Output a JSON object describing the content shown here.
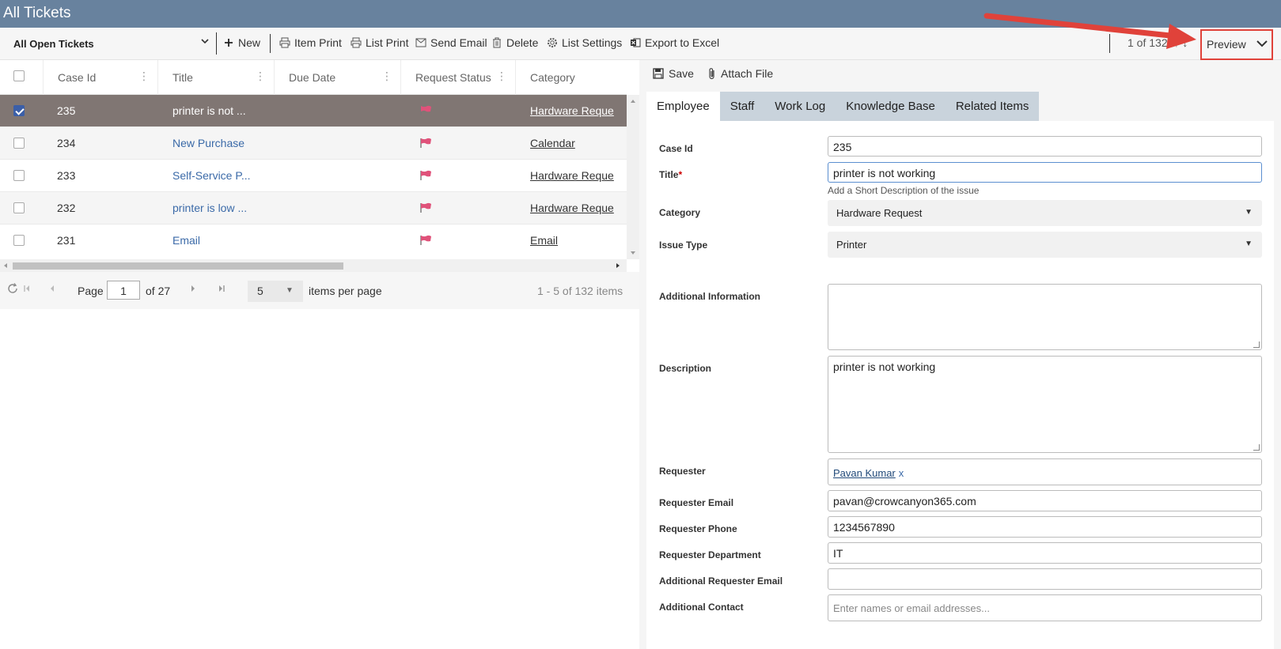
{
  "window": {
    "title": "All Tickets"
  },
  "toolbar": {
    "view": "All Open Tickets",
    "new_label": "New",
    "item_print_label": "Item Print",
    "list_print_label": "List Print",
    "send_email_label": "Send Email",
    "delete_label": "Delete",
    "list_settings_label": "List Settings",
    "export_label": "Export to Excel",
    "record_counter": "1 of 132",
    "preview_label": "Preview"
  },
  "grid": {
    "columns": [
      "Case Id",
      "Title",
      "Due Date",
      "Request Status",
      "Category"
    ],
    "rows": [
      {
        "case_id": "235",
        "title": "printer is not ...",
        "due": "",
        "category": "Hardware Reque",
        "selected": true
      },
      {
        "case_id": "234",
        "title": "New Purchase",
        "due": "",
        "category": "Calendar",
        "selected": false
      },
      {
        "case_id": "233",
        "title": "Self-Service P...",
        "due": "",
        "category": "Hardware Reque",
        "selected": false
      },
      {
        "case_id": "232",
        "title": "printer is low ...",
        "due": "",
        "category": "Hardware Reque",
        "selected": false
      },
      {
        "case_id": "231",
        "title": "Email",
        "due": "",
        "category": "Email",
        "selected": false
      }
    ],
    "pager": {
      "page_label": "Page",
      "page_value": "1",
      "of_label": "of 27",
      "per_page_value": "5",
      "per_page_label": "items per page",
      "summary": "1 - 5 of 132 items"
    }
  },
  "panel": {
    "save_label": "Save",
    "attach_label": "Attach File",
    "tabs": [
      "Employee",
      "Staff",
      "Work Log",
      "Knowledge Base",
      "Related Items"
    ],
    "fields": {
      "case_id_label": "Case Id",
      "case_id_value": "235",
      "title_label": "Title",
      "title_required": "*",
      "title_value": "printer is not working",
      "title_hint": "Add a Short Description of the issue",
      "category_label": "Category",
      "category_value": "Hardware Request",
      "issue_type_label": "Issue Type",
      "issue_type_value": "Printer",
      "additional_info_label": "Additional Information",
      "additional_info_value": "",
      "description_label": "Description",
      "description_value": "printer is not working",
      "requester_label": "Requester",
      "requester_value": "Pavan Kumar",
      "requester_remove": "x",
      "requester_email_label": "Requester Email",
      "requester_email_value": "pavan@crowcanyon365.com",
      "requester_phone_label": "Requester Phone",
      "requester_phone_value": "1234567890",
      "requester_dept_label": "Requester Department",
      "requester_dept_value": "IT",
      "additional_email_label": "Additional Requester Email",
      "additional_email_value": "",
      "additional_contact_label": "Additional Contact",
      "additional_contact_placeholder": "Enter names or email addresses..."
    }
  },
  "colors": {
    "title_bar": "#68829e",
    "selected_row": "#807673",
    "link": "#3b6aa8",
    "annotation": "#e0423a",
    "flag": "#e0527a"
  }
}
